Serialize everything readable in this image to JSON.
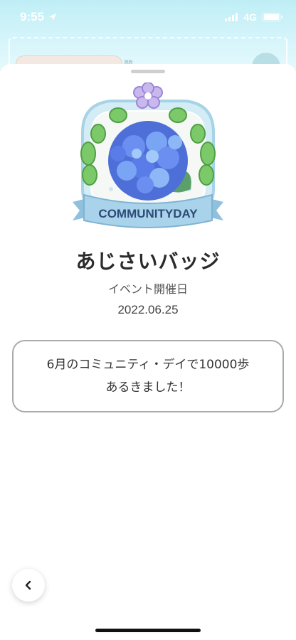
{
  "status_bar": {
    "time": "9:55",
    "network": "4G",
    "icons": [
      "location-arrow-icon",
      "signal-icon",
      "battery-icon"
    ]
  },
  "background_peek": {
    "text": "題"
  },
  "badge": {
    "ribbon_text": "COMMUNITYDAY",
    "flower_color": "#5b7fe0",
    "leaf_color": "#7cc96a",
    "ribbon_color": "#a9d3ea"
  },
  "detail": {
    "title": "あじさいバッジ",
    "subtitle": "イベント開催日",
    "date": "2022.06.25",
    "message_line1": "6月のコミュニティ・デイで10000歩",
    "message_line2": "あるきました！"
  },
  "nav": {
    "back_icon": "chevron-left-icon"
  }
}
